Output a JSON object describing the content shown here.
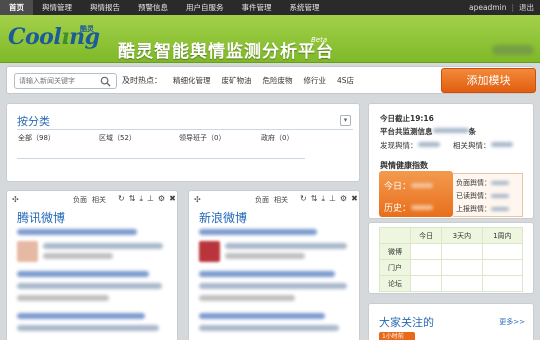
{
  "topnav": {
    "items": [
      "首页",
      "舆情管理",
      "舆情报告",
      "预警信息",
      "用户自服务",
      "事件管理",
      "系统管理"
    ],
    "user": "apeadmin",
    "logout": "退出"
  },
  "banner": {
    "logo_text_a": "Cool",
    "logo_text_b": "ng",
    "logo_small": "酷灵",
    "title": "酷灵智能舆情监测分析平台",
    "beta": "Beta"
  },
  "search": {
    "placeholder": "请输入新闻关键字",
    "hot_label": "及时热点：",
    "hot_items": [
      "精细化管理",
      "废矿物油",
      "危险废物",
      "修行业",
      "4S店"
    ],
    "add_button": "添加模块"
  },
  "classify": {
    "title": "按分类",
    "collapse_icon": "▾",
    "categories": [
      "全部（98）",
      "区域（52）",
      "领导班子（0）",
      "政府（0）"
    ]
  },
  "cards": [
    {
      "title": "腾讯微博",
      "tab_a": "负面",
      "tab_b": "相关"
    },
    {
      "title": "新浪微博",
      "tab_a": "负面",
      "tab_b": "相关"
    }
  ],
  "stats": {
    "today_label": "今日截止19:16",
    "monitor_label": "平台共监测信息",
    "monitor_unit": "条",
    "found_label": "发现舆情：",
    "related_label": "相关舆情：",
    "health_title": "舆情健康指数",
    "today_box": "今日：",
    "history_box": "历史：",
    "health_items": [
      "负面舆情：",
      "已读舆情：",
      "上报舆情："
    ]
  },
  "summary_table": {
    "headers": [
      "",
      "今日",
      "3天内",
      "1周内"
    ],
    "rows": [
      "微博",
      "门户",
      "论坛"
    ]
  },
  "focus": {
    "title": "大家关注的",
    "more": "更多>>",
    "badge": "1小时前"
  },
  "colors": {
    "banner_green": "#8fc434",
    "accent_orange": "#e8691a",
    "link_blue": "#2a6ab3"
  }
}
